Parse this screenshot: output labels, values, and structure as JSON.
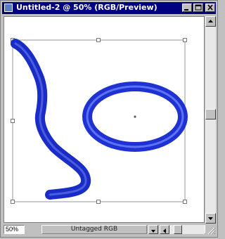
{
  "window": {
    "title": "Untitled-2 @ 50% (RGB/Preview)",
    "titlebar_color": "#000080"
  },
  "title_buttons": [
    {
      "name": "minimize-button",
      "icon": "minimize-icon"
    },
    {
      "name": "maximize-button",
      "icon": "maximize-icon"
    },
    {
      "name": "close-button",
      "icon": "close-icon"
    }
  ],
  "artwork": {
    "stroke_color": "#1e32d2",
    "shapes": [
      "freehand-curve",
      "ellipse"
    ],
    "selection": "bounding-box-with-handles"
  },
  "status": {
    "zoom": "50%",
    "profile": "Untagged RGB"
  }
}
